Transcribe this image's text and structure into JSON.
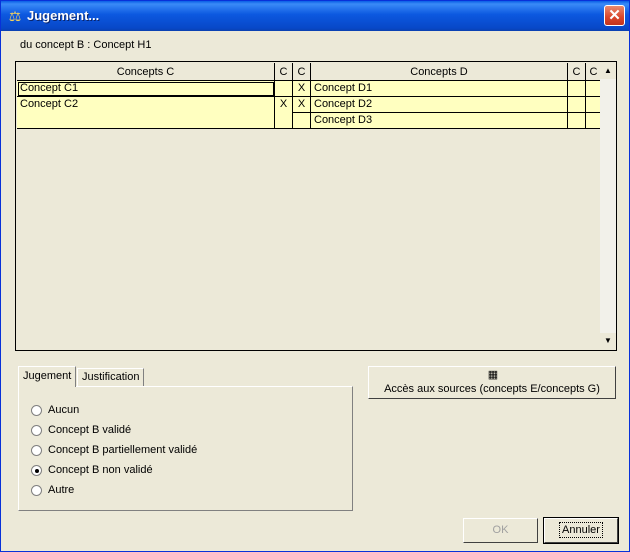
{
  "window": {
    "title": "Jugement...",
    "close_glyph": "✕"
  },
  "subtitle": "du concept B : Concept H1",
  "grid": {
    "headers": {
      "concepts_c": "Concepts C",
      "c1": "C",
      "c2": "C",
      "concepts_d": "Concepts D",
      "c3": "C",
      "c4": "C"
    },
    "rows": [
      {
        "concept_c": "Concept C1",
        "c1": "",
        "c2": "X",
        "concept_d": "Concept D1",
        "c3": "",
        "c4": ""
      },
      {
        "concept_c": "Concept C2",
        "c1": "X",
        "c2": "X",
        "concept_d": "Concept D2",
        "c3": "",
        "c4": ""
      },
      {
        "concept_c": "",
        "c1": "",
        "c2": "",
        "concept_d": "Concept D3",
        "c3": "",
        "c4": ""
      }
    ],
    "scroll_up": "▲",
    "scroll_down": "▼"
  },
  "tabs": {
    "jugement": "Jugement",
    "justification": "Justification"
  },
  "radios": {
    "aucun": "Aucun",
    "valide": "Concept B validé",
    "partiel": "Concept B partiellement validé",
    "non_valide": "Concept B non validé",
    "autre": "Autre",
    "selected": "non_valide"
  },
  "sources_button": {
    "label": "Accès aux sources (concepts E/concepts G)",
    "icon": "building-icon"
  },
  "buttons": {
    "ok": "OK",
    "cancel": "Annuler"
  }
}
